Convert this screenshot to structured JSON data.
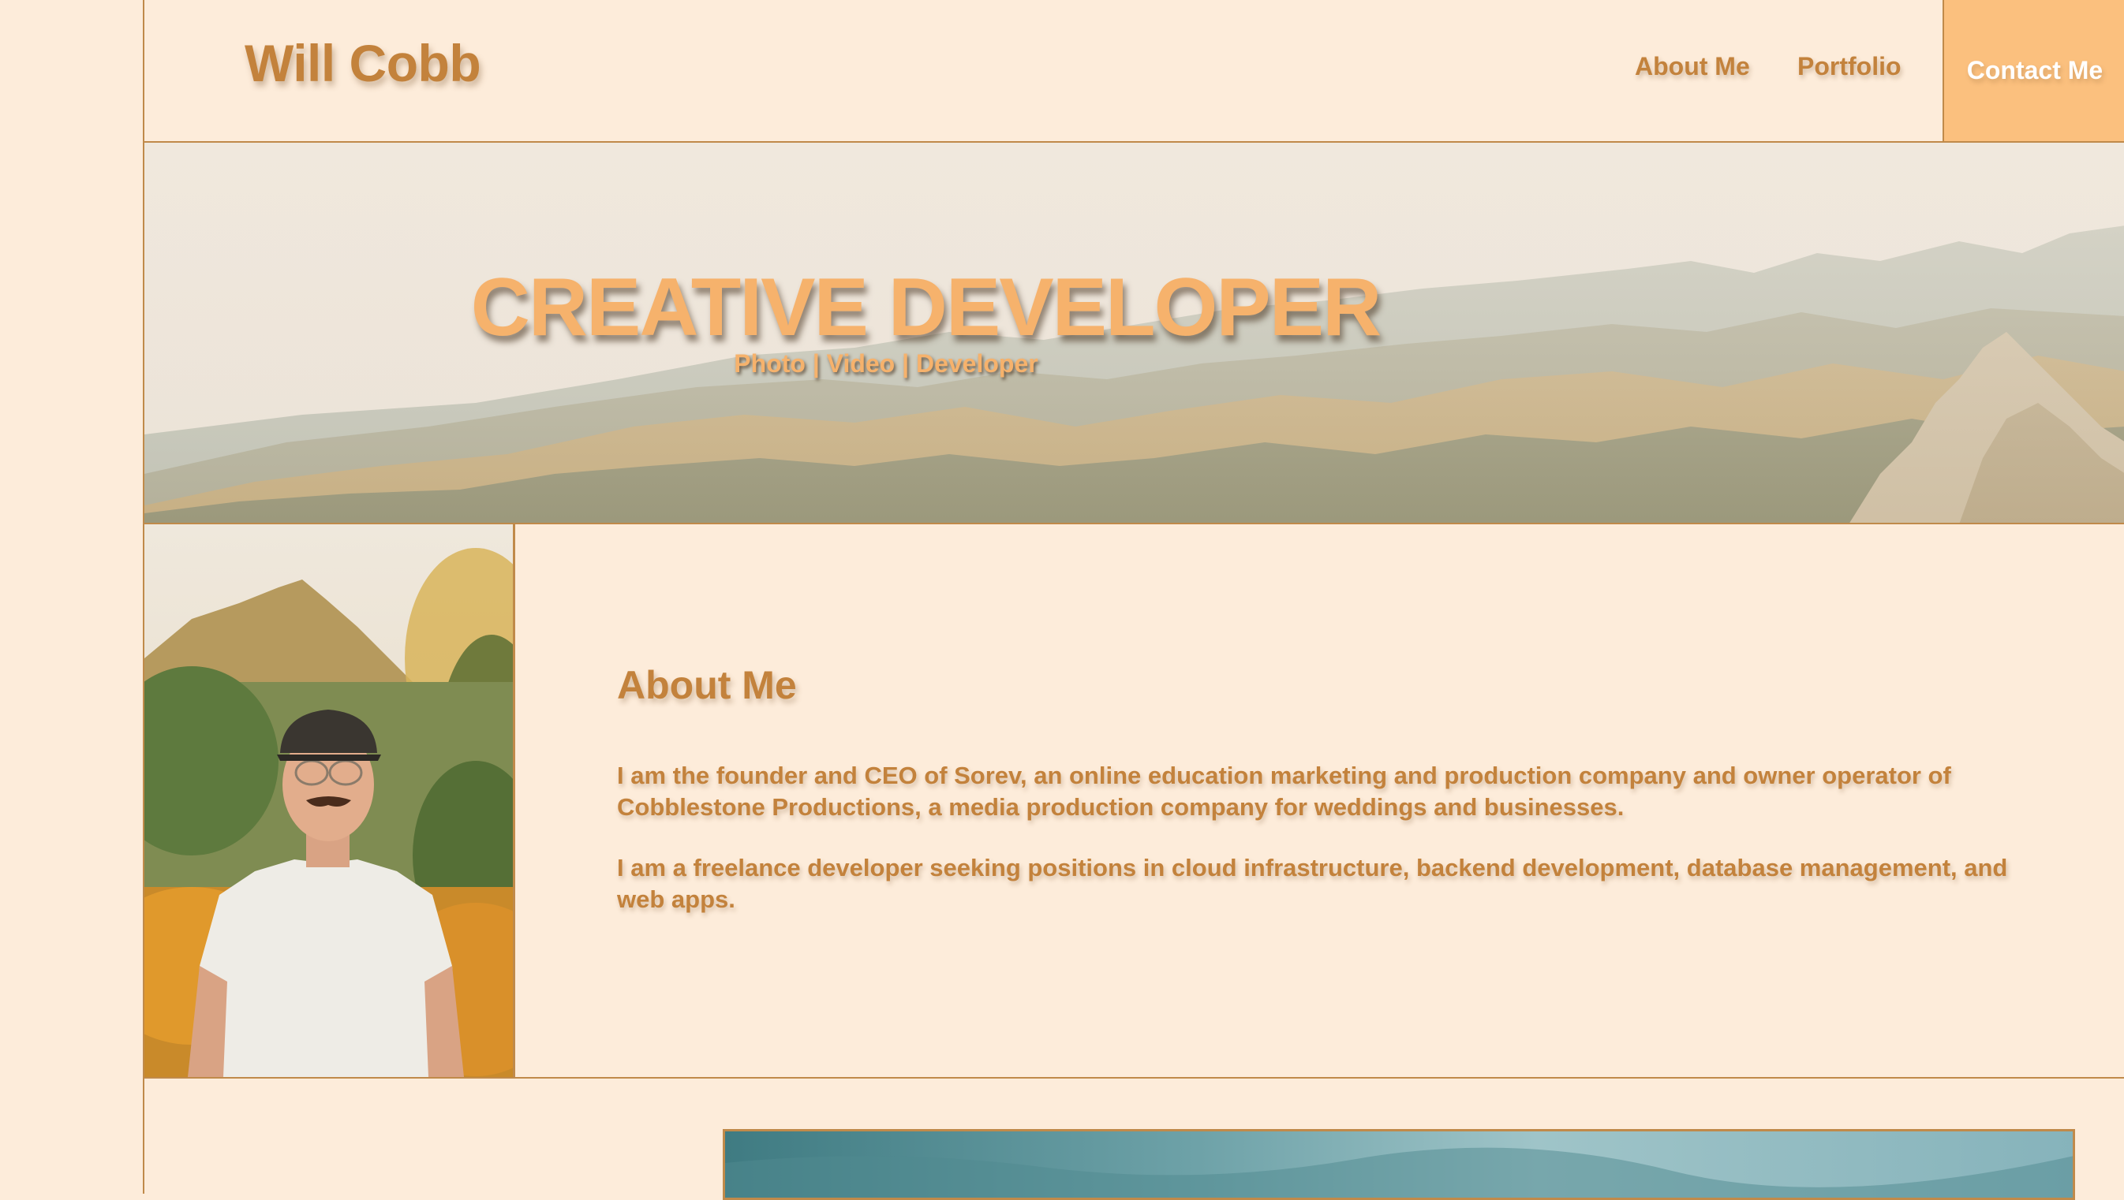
{
  "header": {
    "brand": "Will Cobb",
    "nav": {
      "about": "About Me",
      "portfolio": "Portfolio",
      "contact": "Contact Me"
    }
  },
  "hero": {
    "title": "CREATIVE DEVELOPER",
    "subtitle": "Photo | Video | Developer"
  },
  "about": {
    "title": "About Me",
    "paragraph1": "I am the founder and CEO of Sorev, an online education marketing and production company and owner operator of Cobblestone Productions, a media production company for weddings and businesses.",
    "paragraph2": "I am a freelance developer seeking positions in cloud infrastructure, backend development, database management, and web apps."
  },
  "colors": {
    "background": "#fdecda",
    "accent_text": "#c3823c",
    "hero_text": "#f6b26c",
    "contact_button": "#fbc07e",
    "border": "#c08a4a"
  }
}
